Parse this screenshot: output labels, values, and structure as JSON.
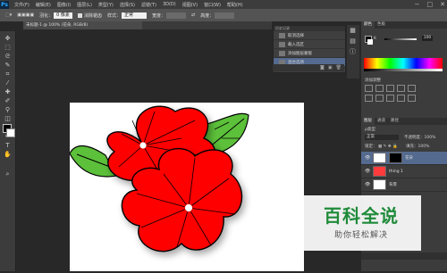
{
  "app": {
    "logo": "Ps"
  },
  "menu": [
    "文件(F)",
    "编辑(E)",
    "图像(I)",
    "图层(L)",
    "类型(Y)",
    "选择(S)",
    "滤镜(T)",
    "3D(D)",
    "视图(V)",
    "窗口(W)",
    "帮助(H)"
  ],
  "window_controls": [
    "−",
    "□",
    "✕"
  ],
  "options": {
    "feather_label": "羽化：",
    "feather_value": "0 像素",
    "antialias_label": "消除锯齿",
    "style_label": "样式：",
    "style_value": "正常",
    "width_label": "宽度：",
    "height_label": "高度："
  },
  "document_tab": "未标题-1 @ 100% (花朵, RGB/8)",
  "history": {
    "title": "历史记录",
    "items": [
      "取消选择",
      "载入选区",
      "添加图层蒙版",
      "混合选项"
    ],
    "selected": "混合选项"
  },
  "right_panel": {
    "color_tabs": [
      "颜色",
      "色板"
    ],
    "slider_label": "K",
    "slider_value": "100",
    "adjust_title": "添加调整",
    "layers_tabs": [
      "图层",
      "通道",
      "路径"
    ],
    "kind_label": "ρ类型",
    "blend_mode": "正常",
    "opacity_label": "不透明度：100%",
    "lock_label": "锁定：",
    "fill_label": "填充：100%",
    "layers": [
      {
        "name": "花朵",
        "selected": true
      },
      {
        "name": "thing 1",
        "selected": false
      },
      {
        "name": "背景",
        "selected": false
      }
    ]
  },
  "colors": {
    "accent": "#546a8f",
    "flower_red": "#ff0000",
    "leaf_green": "#5cc03a"
  },
  "watermark": {
    "title": "百科全说",
    "subtitle": "助你轻松解决"
  }
}
